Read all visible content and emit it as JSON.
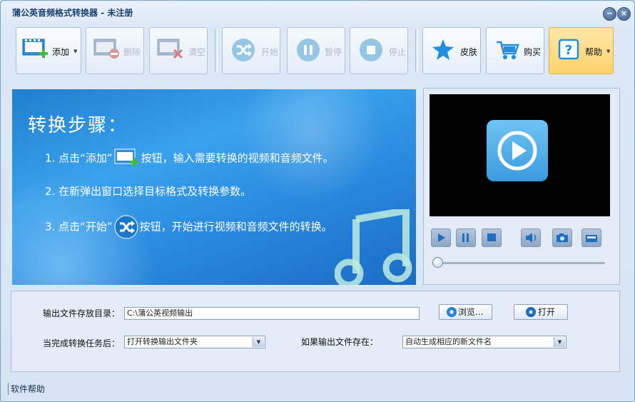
{
  "window": {
    "title": "蒲公英音频格式转换器 - 未注册",
    "minimize_icon": "minimize-icon",
    "close_icon": "close-icon"
  },
  "toolbar": {
    "add": {
      "label": "添加",
      "enabled": true
    },
    "delete": {
      "label": "删除",
      "enabled": false
    },
    "clear": {
      "label": "清空",
      "enabled": false
    },
    "start": {
      "label": "开始",
      "enabled": false
    },
    "pause": {
      "label": "暂停",
      "enabled": false
    },
    "stop": {
      "label": "停止",
      "enabled": false
    },
    "skin": {
      "label": "皮肤",
      "enabled": true
    },
    "buy": {
      "label": "购买",
      "enabled": true
    },
    "help": {
      "label": "帮助",
      "enabled": true
    }
  },
  "banner": {
    "title": "转换步骤：",
    "step1_before": "1. 点击“添加”",
    "step1_after": "按钮，输入需要转换的视频和音频文件。",
    "step2": "2. 在新弹出窗口选择目标格式及转换参数。",
    "step3_before": "3. 点击“开始”",
    "step3_after": "按钮，开始进行视频和音频文件的转换。"
  },
  "player": {
    "progress": 0.0
  },
  "settings": {
    "output_dir_label": "输出文件存放目录：",
    "output_dir_value": "C:\\蒲公英视频输出",
    "browse_label": "浏览...",
    "open_label": "打开",
    "after_task_label": "当完成转换任务后：",
    "after_task_value": "打开转换输出文件夹",
    "if_exists_label": "如果输出文件存在：",
    "if_exists_value": "自动生成相应的新文件名"
  },
  "footer": {
    "help_label": "软件帮助"
  },
  "colors": {
    "accent": "#3b9bde",
    "help_active": "#ffd36d",
    "banner": "#2a8ce0"
  }
}
